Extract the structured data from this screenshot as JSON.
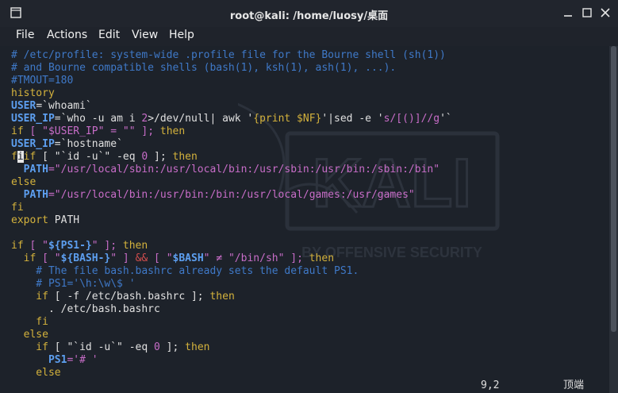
{
  "window": {
    "title": "root@kali: /home/luosy/桌面"
  },
  "icons": {
    "app": "terminal-icon",
    "minimize": "minimize-icon",
    "maximize": "maximize-icon",
    "close": "close-icon"
  },
  "menu": {
    "file": "File",
    "actions": "Actions",
    "edit": "Edit",
    "view": "View",
    "help": "Help"
  },
  "watermark": {
    "logo": "KALI",
    "tagline": "BY OFFENSIVE SECURITY"
  },
  "editor": {
    "l1": "# /etc/profile: system-wide .profile file for the Bourne shell (sh(1))",
    "l2": "# and Bourne compatible shells (bash(1), ksh(1), ash(1), ...).",
    "l3": "#TMOUT=180",
    "l4": "history",
    "l5": {
      "a": "USER",
      "b": "=`whoami`"
    },
    "l6": {
      "a": "USER_IP",
      "b": "=`who -u am i ",
      "c": "2",
      "d": ">/dev/null| awk '",
      "e": "{print $NF}",
      "f": "'|sed -e '",
      "g": "s/[()]//g",
      "h": "'`"
    },
    "l7": {
      "a": "if",
      "b": " [ \"",
      "c": "$USER_IP",
      "d": "\" = \"\" ]; ",
      "e": "then"
    },
    "l8": {
      "a": "USER_IP",
      "b": "=`hostname`"
    },
    "l9": {
      "a": "f",
      "b": "i",
      "c": "if",
      "d": " [ \"`id -u`\" -eq ",
      "e": "0",
      "f": " ]; ",
      "g": "then"
    },
    "l10": {
      "a": "  PATH",
      "b": "=\"/usr/local/sbin:/usr/local/bin:/usr/sbin:/usr/bin:/sbin:/bin\""
    },
    "l11": "else",
    "l12": {
      "a": "  PATH",
      "b": "=\"/usr/local/bin:/usr/bin:/bin:/usr/local/games:/usr/games\""
    },
    "l13": "fi",
    "l14": {
      "a": "export",
      "b": " PATH"
    },
    "l16": {
      "a": "if",
      "b": " [ \"",
      "c": "${PS1-}",
      "d": "\" ]; ",
      "e": "then"
    },
    "l17": {
      "a": "  if",
      "b": " [ \"",
      "c": "${BASH-}",
      "d": "\" ] ",
      "e": "&&",
      "f": " [ \"",
      "g": "$BASH",
      "h": "\" ≠ \"/bin/sh\" ]; ",
      "i": "then"
    },
    "l18": "    # The file bash.bashrc already sets the default PS1.",
    "l19": "    # PS1='\\h:\\w\\$ '",
    "l20": {
      "a": "    if",
      "b": " [ -f /etc/bash.bashrc ]; ",
      "c": "then"
    },
    "l21": "      . /etc/bash.bashrc",
    "l22": "    fi",
    "l23": "  else",
    "l24": {
      "a": "    if",
      "b": " [ \"`id -u`\" -eq ",
      "c": "0",
      "d": " ]; ",
      "e": "then"
    },
    "l25": {
      "a": "      PS1",
      "b": "='# '"
    },
    "l26": "    else"
  },
  "status": {
    "position": "9,2",
    "scroll": "顶端"
  },
  "colors": {
    "background": "#1d222a",
    "comment": "#3f79c8",
    "variable": "#5d9ff0",
    "keyword": "#d4b23c",
    "string": "#c86dc8"
  }
}
